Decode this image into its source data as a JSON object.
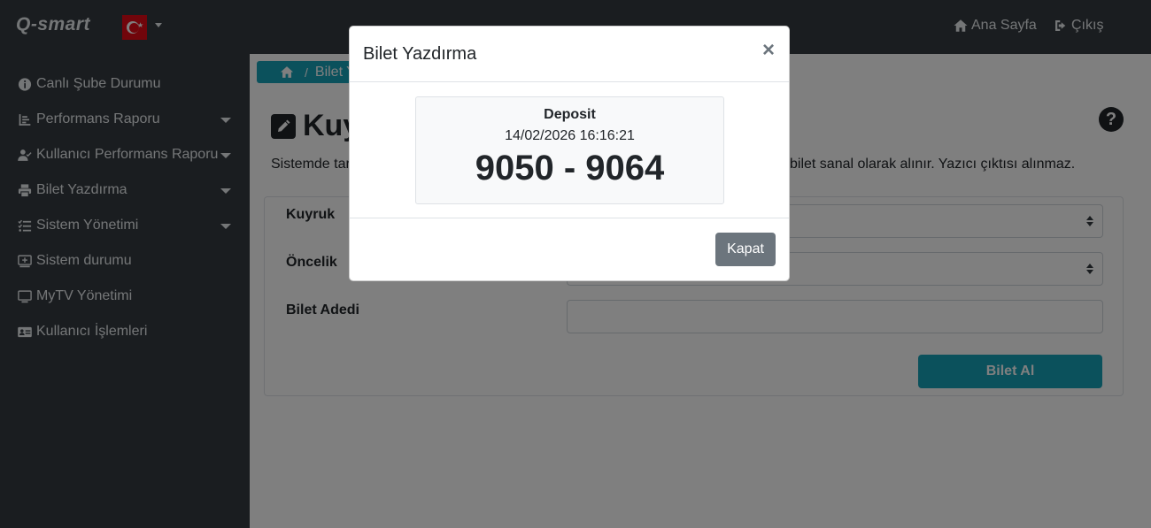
{
  "navbar": {
    "brand": "Q-smart",
    "flag": "Turkey flag",
    "home_label": "Ana Sayfa",
    "exit_label": "Çıkış"
  },
  "sidebar": {
    "items": [
      {
        "label": "Canlı Şube Durumu",
        "icon": "info-circle-icon",
        "has_submenu": false
      },
      {
        "label": "Performans Raporu",
        "icon": "chart-icon",
        "has_submenu": true
      },
      {
        "label": "Kullanıcı Performans Raporu",
        "icon": "user-check-icon",
        "has_submenu": true
      },
      {
        "label": "Bilet Yazdırma",
        "icon": "printer-icon",
        "has_submenu": true
      },
      {
        "label": "Sistem Yönetimi",
        "icon": "tasks-icon",
        "has_submenu": true
      },
      {
        "label": "Sistem durumu",
        "icon": "monitor-icon",
        "has_submenu": false
      },
      {
        "label": "MyTV Yönetimi",
        "icon": "tv-icon",
        "has_submenu": false
      },
      {
        "label": "Kullanıcı İşlemleri",
        "icon": "id-card-icon",
        "has_submenu": false
      }
    ]
  },
  "main": {
    "breadcrumb": "Bilet Y",
    "title": "Kuy",
    "description_left": "Sistemde tar",
    "description_right": "bilet sanal olarak alınır. Yazıcı çıktısı alınmaz.",
    "form": {
      "queue_label": "Kuyruk",
      "queue_value": "",
      "priority_label": "Öncelik",
      "priority_value": "",
      "count_label": "Bilet Adedi",
      "count_value": "",
      "submit_label": "Bilet Al"
    }
  },
  "modal": {
    "title": "Bilet Yazdırma",
    "close_symbol": "×",
    "ticket": {
      "service": "Deposit",
      "datetime": "14/02/2026 16:16:21",
      "range": "9050 - 9064"
    },
    "close_button": "Kapat"
  },
  "colors": {
    "navbar": "#343a40",
    "accent": "#17a2b8",
    "secondary_button": "#6c757d"
  }
}
